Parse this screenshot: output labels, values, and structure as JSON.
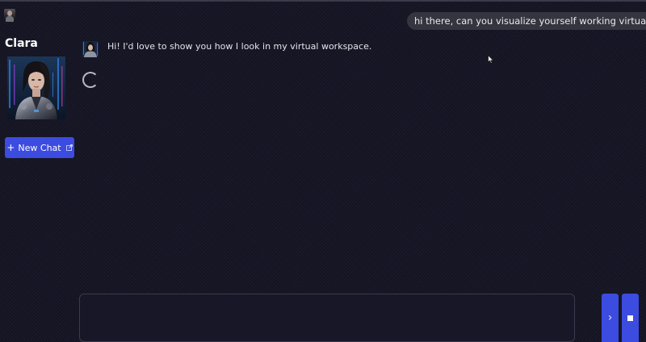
{
  "sidebar": {
    "bot_name": "Clara",
    "portrait_icon": "woman-cyberpunk-portrait",
    "new_chat_label": "New Chat",
    "new_chat_icon": "plus-icon",
    "new_chat_trailing_icon": "external-link-icon"
  },
  "chat": {
    "user_message": "hi there, can you visualize yourself working virtually?",
    "bot_message": "Hi! I'd love to show you how I look in my virtual workspace.",
    "status": "loading"
  },
  "composer": {
    "placeholder": "",
    "send_icon": "chevron-right-icon",
    "stop_icon": "stop-square-icon"
  },
  "colors": {
    "background": "#161626",
    "accent": "#3c4be0",
    "user_bubble": "#35353f"
  }
}
